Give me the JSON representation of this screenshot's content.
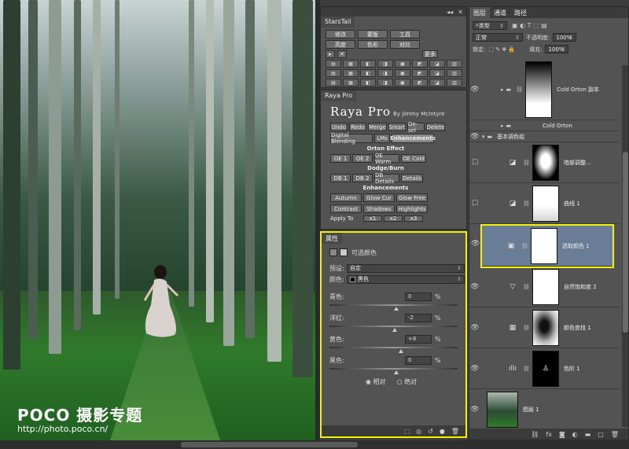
{
  "watermark": {
    "logo": "POCO 摄影专题",
    "url": "http://photo.poco.cn/"
  },
  "starstail": {
    "title": "StarsTail",
    "row1": [
      "修改",
      "蒙版",
      "工具"
    ],
    "row2": [
      "高度",
      "色彩",
      "对比"
    ],
    "more": "更多"
  },
  "raya": {
    "tab": "Raya Pro",
    "title": "Raya Pro",
    "author": "By Jimmy McIntyre",
    "toolbar": [
      "Undo",
      "Redo",
      "Merge",
      "Smart",
      "De-sel",
      "Delete"
    ],
    "tabs": [
      "Digital Blending",
      "LMs",
      "Enhancements"
    ],
    "orton_head": "Orton Effect",
    "orton": [
      "OE 1",
      "OE 2",
      "OE Warm",
      "OE Cold"
    ],
    "dodge_head": "Dodge/Burn",
    "dodge": [
      "DB 1",
      "DB 2",
      "DB Details",
      "Details"
    ],
    "enh_head": "Enhancements",
    "enh1": [
      "Autumn",
      "Glow Cur",
      "Glow Free"
    ],
    "enh2": [
      "Contrast",
      "Shadows",
      "Highlights"
    ],
    "apply": "Apply To",
    "apply_btns": [
      "x1",
      "x2",
      "x3"
    ]
  },
  "properties": {
    "tab": "属性",
    "type": "可选颜色",
    "preset_label": "预设:",
    "preset_value": "自定",
    "color_label": "颜色:",
    "color_value": "黑色",
    "sliders": [
      {
        "label": "青色:",
        "value": "0",
        "unit": "%",
        "pos": 0.5
      },
      {
        "label": "洋红:",
        "value": "-2",
        "unit": "%",
        "pos": 0.49
      },
      {
        "label": "黄色:",
        "value": "+8",
        "unit": "%",
        "pos": 0.54
      },
      {
        "label": "黑色:",
        "value": "0",
        "unit": "%",
        "pos": 0.5
      }
    ],
    "mode_relative": "相对",
    "mode_absolute": "绝对"
  },
  "layers": {
    "tabs": [
      "图层",
      "通道",
      "路径"
    ],
    "filter_kind": "类型",
    "blend_mode": "正常",
    "opacity_label": "不透明度:",
    "opacity_value": "100%",
    "lock_label": "锁定:",
    "fill_label": "填充:",
    "fill_value": "100%",
    "items": [
      {
        "name": "Cold Orton 副本"
      },
      {
        "name": "Cold Orton"
      },
      {
        "name": "基本调色组"
      },
      {
        "name": "暗部调整..."
      },
      {
        "name": "曲线 1"
      },
      {
        "name": "选取颜色 1"
      },
      {
        "name": "自然饱和度 2"
      },
      {
        "name": "颜色查找 1"
      },
      {
        "name": "色阶 1"
      },
      {
        "name": "图层 1"
      }
    ],
    "footer_icons": [
      "link-icon",
      "fx-icon",
      "mask-icon",
      "adjustment-icon",
      "folder-icon",
      "new-layer-icon",
      "trash-icon"
    ]
  }
}
